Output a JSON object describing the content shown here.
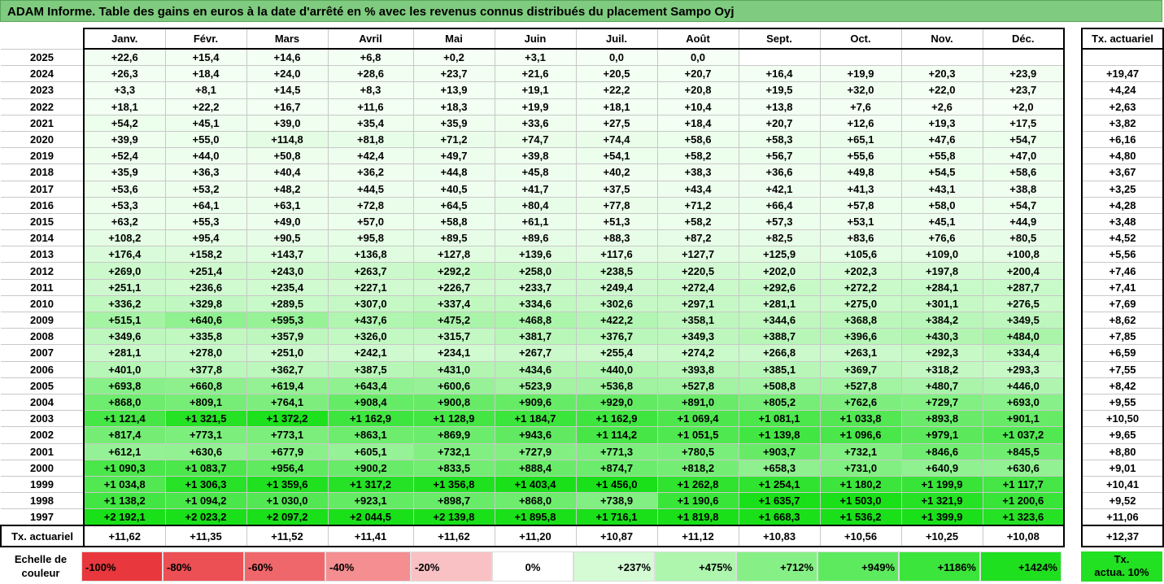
{
  "title": "ADAM Informe. Table des gains en euros à la date d'arrêté en % avec les revenus connus distribués du placement Sampo Oyj",
  "months": [
    "Janv.",
    "Févr.",
    "Mars",
    "Avril",
    "Mai",
    "Juin",
    "Juil.",
    "Août",
    "Sept.",
    "Oct.",
    "Nov.",
    "Déc."
  ],
  "side_header": "Tx. actuariel",
  "rows": [
    {
      "year": "2025",
      "values": [
        "+22,6",
        "+15,4",
        "+14,6",
        "+6,8",
        "+0,2",
        "+3,1",
        "0,0",
        "0,0",
        "",
        "",
        "",
        ""
      ],
      "rate": ""
    },
    {
      "year": "2024",
      "values": [
        "+26,3",
        "+18,4",
        "+24,0",
        "+28,6",
        "+23,7",
        "+21,6",
        "+20,5",
        "+20,7",
        "+16,4",
        "+19,9",
        "+20,3",
        "+23,9"
      ],
      "rate": "+19,47"
    },
    {
      "year": "2023",
      "values": [
        "+3,3",
        "+8,1",
        "+14,5",
        "+8,3",
        "+13,9",
        "+19,1",
        "+22,2",
        "+20,8",
        "+19,5",
        "+32,0",
        "+22,0",
        "+23,7"
      ],
      "rate": "+4,24"
    },
    {
      "year": "2022",
      "values": [
        "+18,1",
        "+22,2",
        "+16,7",
        "+11,6",
        "+18,3",
        "+19,9",
        "+18,1",
        "+10,4",
        "+13,8",
        "+7,6",
        "+2,6",
        "+2,0"
      ],
      "rate": "+2,63"
    },
    {
      "year": "2021",
      "values": [
        "+54,2",
        "+45,1",
        "+39,0",
        "+35,4",
        "+35,9",
        "+33,6",
        "+27,5",
        "+18,4",
        "+20,7",
        "+12,6",
        "+19,3",
        "+17,5"
      ],
      "rate": "+3,82"
    },
    {
      "year": "2020",
      "values": [
        "+39,9",
        "+55,0",
        "+114,8",
        "+81,8",
        "+71,2",
        "+74,7",
        "+74,4",
        "+58,6",
        "+58,3",
        "+65,1",
        "+47,6",
        "+54,7"
      ],
      "rate": "+6,16"
    },
    {
      "year": "2019",
      "values": [
        "+52,4",
        "+44,0",
        "+50,8",
        "+42,4",
        "+49,7",
        "+39,8",
        "+54,1",
        "+58,2",
        "+56,7",
        "+55,6",
        "+55,8",
        "+47,0"
      ],
      "rate": "+4,80"
    },
    {
      "year": "2018",
      "values": [
        "+35,9",
        "+36,3",
        "+40,4",
        "+36,2",
        "+44,8",
        "+45,8",
        "+40,2",
        "+38,3",
        "+36,6",
        "+49,8",
        "+54,5",
        "+58,6"
      ],
      "rate": "+3,67"
    },
    {
      "year": "2017",
      "values": [
        "+53,6",
        "+53,2",
        "+48,2",
        "+44,5",
        "+40,5",
        "+41,7",
        "+37,5",
        "+43,4",
        "+42,1",
        "+41,3",
        "+43,1",
        "+38,8"
      ],
      "rate": "+3,25"
    },
    {
      "year": "2016",
      "values": [
        "+53,3",
        "+64,1",
        "+63,1",
        "+72,8",
        "+64,5",
        "+80,4",
        "+77,8",
        "+71,2",
        "+66,4",
        "+57,8",
        "+58,0",
        "+54,7"
      ],
      "rate": "+4,28"
    },
    {
      "year": "2015",
      "values": [
        "+63,2",
        "+55,3",
        "+49,0",
        "+57,0",
        "+58,8",
        "+61,1",
        "+51,3",
        "+58,2",
        "+57,3",
        "+53,1",
        "+45,1",
        "+44,9"
      ],
      "rate": "+3,48"
    },
    {
      "year": "2014",
      "values": [
        "+108,2",
        "+95,4",
        "+90,5",
        "+95,8",
        "+89,5",
        "+89,6",
        "+88,3",
        "+87,2",
        "+82,5",
        "+83,6",
        "+76,6",
        "+80,5"
      ],
      "rate": "+4,52"
    },
    {
      "year": "2013",
      "values": [
        "+176,4",
        "+158,2",
        "+143,7",
        "+136,8",
        "+127,8",
        "+139,6",
        "+117,6",
        "+127,7",
        "+125,9",
        "+105,6",
        "+109,0",
        "+100,8"
      ],
      "rate": "+5,56"
    },
    {
      "year": "2012",
      "values": [
        "+269,0",
        "+251,4",
        "+243,0",
        "+263,7",
        "+292,2",
        "+258,0",
        "+238,5",
        "+220,5",
        "+202,0",
        "+202,3",
        "+197,8",
        "+200,4"
      ],
      "rate": "+7,46"
    },
    {
      "year": "2011",
      "values": [
        "+251,1",
        "+236,6",
        "+235,4",
        "+227,1",
        "+226,7",
        "+233,7",
        "+249,4",
        "+272,4",
        "+292,6",
        "+272,2",
        "+284,1",
        "+287,7"
      ],
      "rate": "+7,41"
    },
    {
      "year": "2010",
      "values": [
        "+336,2",
        "+329,8",
        "+289,5",
        "+307,0",
        "+337,4",
        "+334,6",
        "+302,6",
        "+297,1",
        "+281,1",
        "+275,0",
        "+301,1",
        "+276,5"
      ],
      "rate": "+7,69"
    },
    {
      "year": "2009",
      "values": [
        "+515,1",
        "+640,6",
        "+595,3",
        "+437,6",
        "+475,2",
        "+468,8",
        "+422,2",
        "+358,1",
        "+344,6",
        "+368,8",
        "+384,2",
        "+349,5"
      ],
      "rate": "+8,62"
    },
    {
      "year": "2008",
      "values": [
        "+349,6",
        "+335,8",
        "+357,9",
        "+326,0",
        "+315,7",
        "+381,7",
        "+376,7",
        "+349,3",
        "+388,7",
        "+396,6",
        "+430,3",
        "+484,0"
      ],
      "rate": "+7,85"
    },
    {
      "year": "2007",
      "values": [
        "+281,1",
        "+278,0",
        "+251,0",
        "+242,1",
        "+234,1",
        "+267,7",
        "+255,4",
        "+274,2",
        "+266,8",
        "+263,1",
        "+292,3",
        "+334,4"
      ],
      "rate": "+6,59"
    },
    {
      "year": "2006",
      "values": [
        "+401,0",
        "+377,8",
        "+362,7",
        "+387,5",
        "+431,0",
        "+434,6",
        "+440,0",
        "+393,8",
        "+385,1",
        "+369,7",
        "+318,2",
        "+293,3"
      ],
      "rate": "+7,55"
    },
    {
      "year": "2005",
      "values": [
        "+693,8",
        "+660,8",
        "+619,4",
        "+643,4",
        "+600,6",
        "+523,9",
        "+536,8",
        "+527,8",
        "+508,8",
        "+527,8",
        "+480,7",
        "+446,0"
      ],
      "rate": "+8,42"
    },
    {
      "year": "2004",
      "values": [
        "+868,0",
        "+809,1",
        "+764,1",
        "+908,4",
        "+900,8",
        "+909,6",
        "+929,0",
        "+891,0",
        "+805,2",
        "+762,6",
        "+729,7",
        "+693,0"
      ],
      "rate": "+9,55"
    },
    {
      "year": "2003",
      "values": [
        "+1 121,4",
        "+1 321,5",
        "+1 372,2",
        "+1 162,9",
        "+1 128,9",
        "+1 184,7",
        "+1 162,9",
        "+1 069,4",
        "+1 081,1",
        "+1 033,8",
        "+893,8",
        "+901,1"
      ],
      "rate": "+10,50"
    },
    {
      "year": "2002",
      "values": [
        "+817,4",
        "+773,1",
        "+773,1",
        "+863,1",
        "+869,9",
        "+943,6",
        "+1 114,2",
        "+1 051,5",
        "+1 139,8",
        "+1 096,6",
        "+979,1",
        "+1 037,2"
      ],
      "rate": "+9,65"
    },
    {
      "year": "2001",
      "values": [
        "+612,1",
        "+630,6",
        "+677,9",
        "+605,1",
        "+732,1",
        "+727,9",
        "+771,3",
        "+780,5",
        "+903,7",
        "+732,1",
        "+846,6",
        "+845,5"
      ],
      "rate": "+8,80"
    },
    {
      "year": "2000",
      "values": [
        "+1 090,3",
        "+1 083,7",
        "+956,4",
        "+900,2",
        "+833,5",
        "+888,4",
        "+874,7",
        "+818,2",
        "+658,3",
        "+731,0",
        "+640,9",
        "+630,6"
      ],
      "rate": "+9,01"
    },
    {
      "year": "1999",
      "values": [
        "+1 034,8",
        "+1 306,3",
        "+1 359,6",
        "+1 317,2",
        "+1 356,8",
        "+1 403,4",
        "+1 456,0",
        "+1 262,8",
        "+1 254,1",
        "+1 180,2",
        "+1 199,9",
        "+1 117,7"
      ],
      "rate": "+10,41"
    },
    {
      "year": "1998",
      "values": [
        "+1 138,2",
        "+1 094,2",
        "+1 030,0",
        "+923,1",
        "+898,7",
        "+868,0",
        "+738,9",
        "+1 190,6",
        "+1 635,7",
        "+1 503,0",
        "+1 321,9",
        "+1 200,6"
      ],
      "rate": "+9,52"
    },
    {
      "year": "1997",
      "values": [
        "+2 192,1",
        "+2 023,2",
        "+2 097,2",
        "+2 044,5",
        "+2 139,8",
        "+1 895,8",
        "+1 716,1",
        "+1 819,8",
        "+1 668,3",
        "+1 536,2",
        "+1 399,9",
        "+1 323,6"
      ],
      "rate": "+11,06"
    }
  ],
  "footer": {
    "label": "Tx. actuariel",
    "values": [
      "+11,62",
      "+11,35",
      "+11,52",
      "+11,41",
      "+11,62",
      "+11,20",
      "+10,87",
      "+11,12",
      "+10,83",
      "+10,56",
      "+10,25",
      "+10,08"
    ],
    "total": "+12,37"
  },
  "legend": {
    "label_line1": "Echelle de",
    "label_line2": "couleur",
    "swatches": [
      {
        "text": "-100%",
        "color": "#e8383d",
        "kind": "neg"
      },
      {
        "text": "-80%",
        "color": "#ec4f54",
        "kind": "neg"
      },
      {
        "text": "-60%",
        "color": "#f0676b",
        "kind": "neg"
      },
      {
        "text": "-40%",
        "color": "#f48e91",
        "kind": "neg"
      },
      {
        "text": "-20%",
        "color": "#f9c1c3",
        "kind": "neg"
      },
      {
        "text": "0%",
        "color": "#ffffff",
        "kind": "zero"
      },
      {
        "text": "+237%",
        "color": "#d4fbd4",
        "kind": "pos"
      },
      {
        "text": "+475%",
        "color": "#aef5ae",
        "kind": "pos"
      },
      {
        "text": "+712%",
        "color": "#86f086",
        "kind": "pos"
      },
      {
        "text": "+949%",
        "color": "#5eea5e",
        "kind": "pos"
      },
      {
        "text": "+1186%",
        "color": "#3be53b",
        "kind": "pos"
      },
      {
        "text": "+1424%",
        "color": "#1fe01f",
        "kind": "pos"
      }
    ],
    "side_line1": "Tx.",
    "side_line2": "actua. 10%",
    "side_color": "#22e022"
  }
}
